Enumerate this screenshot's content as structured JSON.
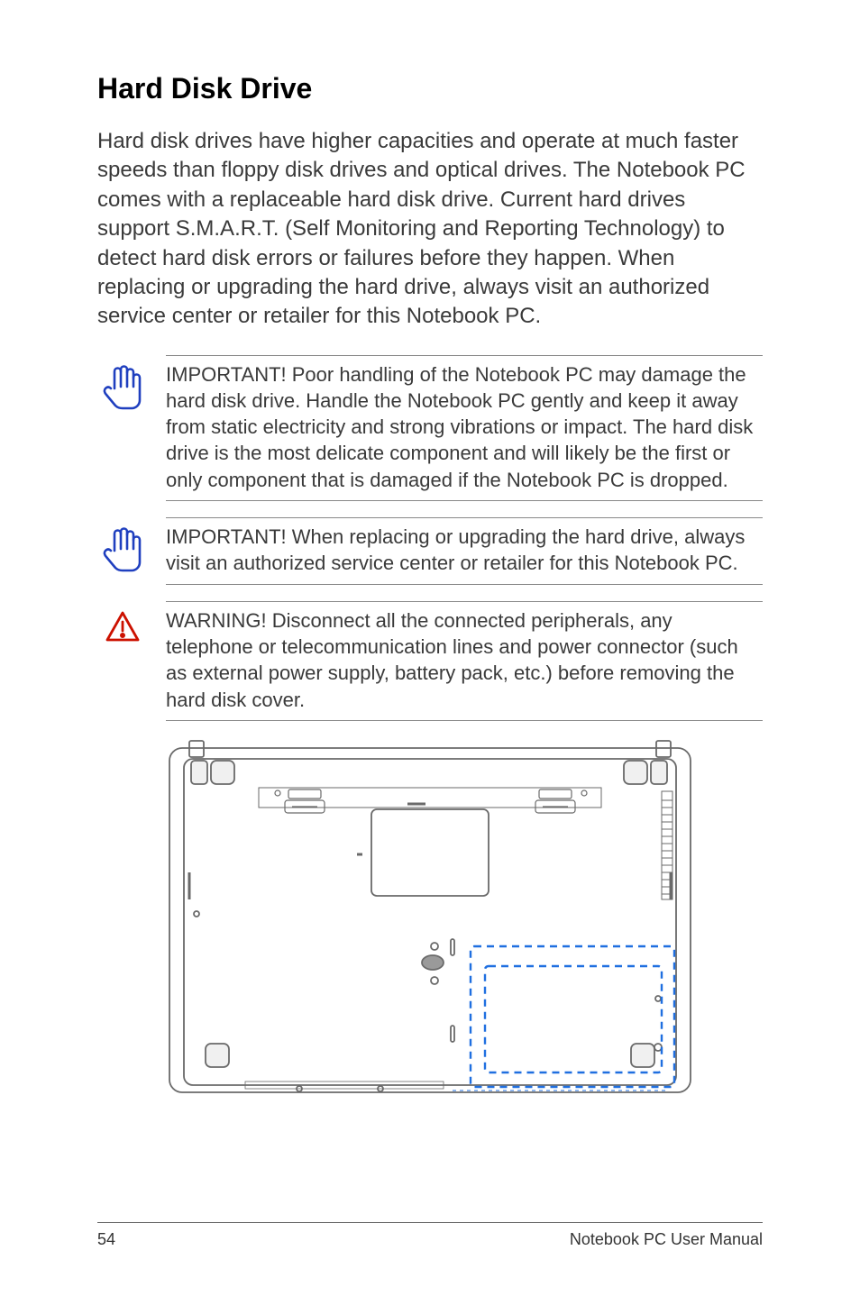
{
  "heading": "Hard Disk Drive",
  "body": "Hard disk drives have higher capacities and operate at much faster speeds than floppy disk drives and optical drives. The Notebook PC comes with a replaceable hard disk drive. Current hard drives support S.M.A.R.T. (Self Monitoring and Reporting Technology) to detect hard disk errors or failures before they happen. When replacing or upgrading the hard drive, always visit an authorized service center or retailer for this Notebook PC.",
  "callouts": {
    "important1": "IMPORTANT!  Poor handling of the Notebook PC may damage the hard disk drive. Handle the Notebook PC gently and keep it away from static electricity and strong vibrations or impact. The hard disk drive is the most delicate component and will likely be the first or only component that is damaged if the Notebook PC is dropped.",
    "important2": "IMPORTANT!  When replacing or upgrading the hard drive, always visit an authorized service center or retailer for this Notebook PC.",
    "warning": "WARNING! Disconnect all the connected peripherals, any telephone or telecommunication lines and power connector (such as external power supply, battery pack, etc.) before removing the hard disk cover."
  },
  "footer": {
    "page": "54",
    "title": "Notebook PC User Manual"
  }
}
